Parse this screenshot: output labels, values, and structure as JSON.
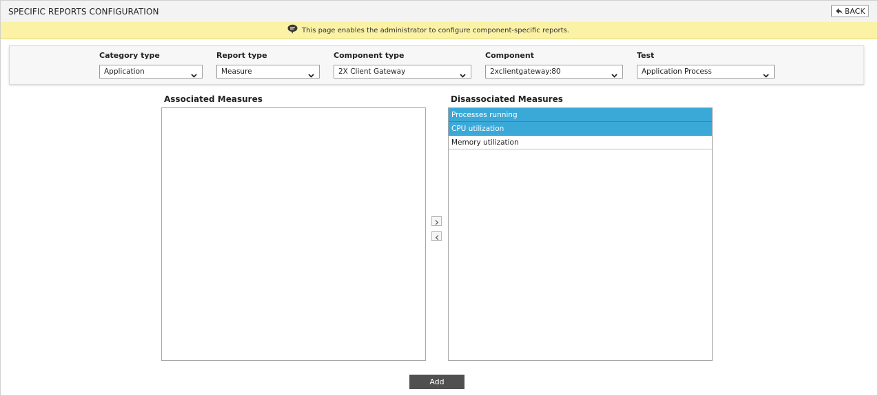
{
  "header": {
    "title": "SPECIFIC REPORTS CONFIGURATION",
    "back_label": "BACK"
  },
  "info": {
    "message": "This page enables the administrator to configure component-specific reports."
  },
  "filters": {
    "category_type": {
      "label": "Category type",
      "value": "Application"
    },
    "report_type": {
      "label": "Report type",
      "value": "Measure"
    },
    "component_type": {
      "label": "Component type",
      "value": "2X Client Gateway"
    },
    "component": {
      "label": "Component",
      "value": "2xclientgateway:80"
    },
    "test": {
      "label": "Test",
      "value": "Application Process"
    }
  },
  "associated": {
    "title": "Associated Measures",
    "items": []
  },
  "disassociated": {
    "title": "Disassociated Measures",
    "items": [
      {
        "label": "Processes running",
        "selected": true
      },
      {
        "label": "CPU utilization",
        "selected": true
      },
      {
        "label": "Memory utilization",
        "selected": false
      }
    ]
  },
  "actions": {
    "add_label": "Add"
  },
  "colors": {
    "selected_item": "#3ba9d8",
    "info_bar": "#fbf2a6",
    "add_button": "#505050"
  }
}
